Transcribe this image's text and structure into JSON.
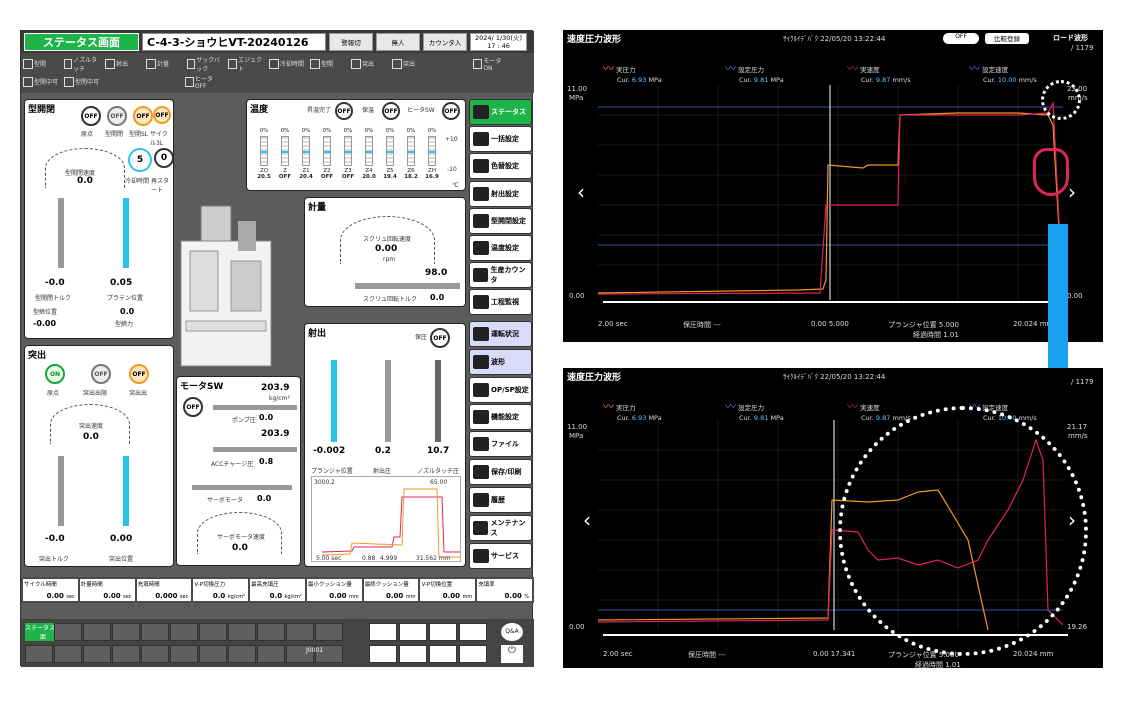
{
  "left": {
    "screen_title": "ステータス画面",
    "mold_name": "C-4-3-ショウヒVT-20240126",
    "top_buttons": [
      "警報切",
      "無人",
      "カウンタ入"
    ],
    "date": "2024/ 1/30(火)",
    "time": "17 : 46",
    "tools": [
      "型開",
      "ノズルタッチ",
      "射出",
      "計量",
      "サックバック",
      "エジェクト",
      "冷却時間",
      "型開",
      "突出",
      "突出",
      "モータ ON",
      "型開中可",
      "型閉中可",
      "ヒータ OFF"
    ],
    "mold_panel": {
      "title": "型開閉",
      "btns": [
        "OFF",
        "OFF",
        "OFF",
        "OFF"
      ],
      "labels": [
        "原点",
        "型開閉",
        "型開SL",
        "サイクル3L"
      ],
      "gauge_label": "型開閉速度",
      "gauge_val": "0.0",
      "unit": "%",
      "timer1": "5",
      "timer2": "0",
      "timer1_label": "冷却時間",
      "timer2_label": "再スタート",
      "torque": "-0.0",
      "torque_unit": "%",
      "torque_label": "型開閉トルク",
      "platen": "0.05",
      "platen_unit": "mm",
      "platen_label": "プラテン位置",
      "bar_top": "100",
      "bar_mid": "0",
      "bar_bot": "100",
      "pos_label": "型締位置",
      "pos_val": "-0.00",
      "pos_unit": "mm",
      "force_label": "型締力",
      "force_val": "0.0",
      "force_unit": "kN"
    },
    "temp_panel": {
      "title": "温度",
      "extra": [
        "昇温完了",
        "保温",
        "ヒータSW"
      ],
      "btns": [
        "OFF",
        "OFF",
        "OFF"
      ],
      "zones": [
        "ZO",
        "Z",
        "Z1",
        "Z2",
        "Z3",
        "Z4",
        "Z5",
        "Z6",
        "ZH"
      ],
      "pcts": [
        "0%",
        "0%",
        "0%",
        "0%",
        "0%",
        "0%",
        "0%",
        "0%",
        "0%"
      ],
      "temps": [
        "20.5",
        "OFF",
        "20.4",
        "OFF",
        "OFF",
        "20.0",
        "19.4",
        "18.2",
        "16.9"
      ],
      "unit": "℃",
      "scale_top": "+10",
      "scale_bot": "-10"
    },
    "meter_panel": {
      "title": "計量",
      "gauge_label": "スクリュ回転速度",
      "gauge_val": "0.00",
      "gauge_unit": "rpm",
      "ticks": [
        "66.7",
        "133.3",
        "200.0",
        "266.7",
        "333.3",
        "400.0",
        "0"
      ],
      "torque_val": "98.0",
      "torque_unit": "Nm",
      "torque_label": "スクリュ回転トルク",
      "torque_val2": "0.0",
      "torque_unit2": "Nm"
    },
    "eject_panel": {
      "title": "突出",
      "btns": [
        "ON",
        "OFF",
        "OFF"
      ],
      "labels": [
        "原点",
        "突出出限",
        "突出出"
      ],
      "gauge_label": "突出速度",
      "gauge_val": "0.0",
      "unit": "%",
      "force": "-0.0",
      "force_unit": "%",
      "force_label": "突出トルク",
      "pos": "0.00",
      "pos_unit": "mm",
      "pos_label": "突出位置"
    },
    "motor_panel": {
      "title": "モータSW",
      "btn": "OFF",
      "pump_val": "203.9",
      "pump_unit": "kg/cm²",
      "pump_label": "ポンプ圧",
      "pump_val2": "0.0",
      "pump_unit2": "kg/cm²",
      "acc_val": "203.9",
      "acc_unit": "kg/cm²",
      "acc_label": "ACCチャージ圧",
      "acc_val2": "0.8",
      "acc_unit2": "kg/cm²",
      "servo_label": "サーボモータ",
      "servo_val": "0.0",
      "servo_unit": "%",
      "gauge_label": "サーボモータ速度",
      "gauge_val": "0.0",
      "gauge_unit": "%"
    },
    "inject_panel": {
      "title": "射出",
      "btn_label": "保圧",
      "btn": "OFF",
      "plunger_val": "-0.002",
      "plunger_unit": "mm",
      "plunger_label": "プランジャ位置",
      "press_val": "0.2",
      "press_unit": "kg/cm²",
      "press_label": "射出圧",
      "nozzle_val": "10.7",
      "nozzle_unit": "kg/cm²",
      "nozzle_label": "ノズルタッチ圧",
      "mini_times": [
        "5.00 sec",
        "0.88",
        "4.999",
        "31.562 mm"
      ],
      "mini_top": "3000.2",
      "mini_right": "65.00"
    },
    "side_buttons": [
      "ステータス",
      "一括設定",
      "色替設定",
      "射出設定",
      "型開閉設定",
      "温度設定",
      "生産カウンタ",
      "工程監視",
      "運転状況",
      "波形",
      "OP/SP設定",
      "機能設定",
      "ファイル",
      "保存/印刷",
      "履歴",
      "メンテナンス",
      "サービス"
    ],
    "status_bar": [
      {
        "label": "サイクル時間",
        "val": "0.00",
        "unit": "sec"
      },
      {
        "label": "計量時間",
        "val": "0.00",
        "unit": "sec"
      },
      {
        "label": "充填時間",
        "val": "0.000",
        "unit": "sec"
      },
      {
        "label": "V-P切換圧力",
        "val": "0.0",
        "unit": "kg/cm²"
      },
      {
        "label": "最高充填圧",
        "val": "0.0",
        "unit": "kg/cm²"
      },
      {
        "label": "最小クッション量",
        "val": "0.00",
        "unit": "mm"
      },
      {
        "label": "最終クッション量",
        "val": "0.00",
        "unit": "mm"
      },
      {
        "label": "V-P切換位置",
        "val": "0.00",
        "unit": "mm"
      },
      {
        "label": "充填率",
        "val": "0.00",
        "unit": "%"
      }
    ],
    "bottom_status": "ステータス画面",
    "bottom_code": "J0001"
  },
  "chart_top": {
    "title": "速度圧力波形",
    "meta": "ｻｲｸﾙｲﾃﾞﾊﾞｸ  22/05/20 13:22:44",
    "off": "OFF",
    "compare": "比較登録",
    "load": "ロード波形",
    "count": "/ 1179",
    "legend": [
      {
        "name": "実圧力",
        "sub": "Cur.",
        "val": "6.93",
        "unit": "MPa",
        "color": "#f39a1e"
      },
      {
        "name": "設定圧力",
        "sub": "Cur.",
        "val": "9.81",
        "unit": "MPa",
        "color": "#5e7bff"
      },
      {
        "name": "実速度",
        "sub": "Cur.",
        "val": "9.87",
        "unit": "mm/s",
        "color": "#e0245a"
      },
      {
        "name": "設定速度",
        "sub": "Cur.",
        "val": "10.00",
        "unit": "mm/s",
        "color": "#5e7bff"
      }
    ],
    "y_left_top": "11.00",
    "y_left_unit": "MPa",
    "y_left_bot": "0.00",
    "y_right_top": "23.00",
    "y_right_unit": "mm/s",
    "y_right_bot": "0.00",
    "x_left": "2.00 sec",
    "hold": "保圧時間 ---",
    "x_mid": "0.00 5.000",
    "plunger": "プランジャ位置 5.000",
    "elapsed": "経過時間 1.01",
    "x_right": "20.024 mm"
  },
  "chart_bottom": {
    "title": "速度圧力波形",
    "meta": "ｻｲｸﾙｲﾃﾞﾊﾞｸ  22/05/20 13:22:44",
    "count": "/ 1179",
    "legend": [
      {
        "name": "実圧力",
        "sub": "Cur.",
        "val": "6.93",
        "unit": "MPa",
        "color": "#f39a1e"
      },
      {
        "name": "設定圧力",
        "sub": "Cur.",
        "val": "9.81",
        "unit": "MPa",
        "color": "#5e7bff"
      },
      {
        "name": "実速度",
        "sub": "Cur.",
        "val": "9.87",
        "unit": "mm/s",
        "color": "#e0245a"
      },
      {
        "name": "設定速度",
        "sub": "Cur.",
        "val": "10.00",
        "unit": "mm/s",
        "color": "#5e7bff"
      }
    ],
    "y_left_top": "11.00",
    "y_left_unit": "MPa",
    "y_left_bot": "0.00",
    "y_right_top": "21.17",
    "y_right_unit": "mm/s",
    "y_right_bot": "19.26",
    "x_left": "2.00 sec",
    "hold": "保圧時間 ---",
    "x_mid": "0.00 17.341",
    "plunger": "プランジャ位置 5.000",
    "elapsed": "経過時間 1.01",
    "x_right": "20.024 mm"
  }
}
